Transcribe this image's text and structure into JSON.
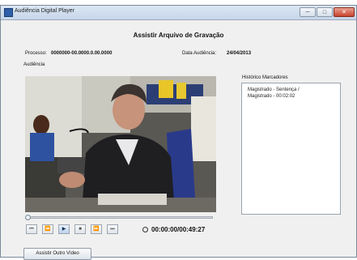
{
  "window": {
    "title": "Audiência Digital Player",
    "minimize": "─",
    "maximize": "□",
    "close": "✕"
  },
  "page": {
    "heading": "Assistir Arquivo de Gravação"
  },
  "info": {
    "processo_label": "Processo:",
    "processo_value": "0000000-00.0000.0.00.0000",
    "data_label": "Data Audiência:",
    "data_value": "24/04/2013"
  },
  "panels": {
    "audiencia_label": "Audiência",
    "historico_label": "Histórico Marcadores"
  },
  "historico": {
    "lines": [
      "Magistrado - Sentença /",
      "Magistrado - 00:02:02"
    ]
  },
  "player": {
    "time": "00:00:00/00:49:27",
    "progress": 0.0,
    "controls": [
      "⏮",
      "⏪",
      "▶",
      "■",
      "⏩",
      "⏭"
    ]
  },
  "buttons": {
    "assistir_outro": "Assistir Outro Vídeo"
  },
  "colors": {
    "titlebar": "#c6d6ea",
    "window_bg": "#f0f0f0",
    "close": "#c8432e"
  },
  "icons": {
    "app": "app-icon",
    "clock": "clock-icon"
  }
}
